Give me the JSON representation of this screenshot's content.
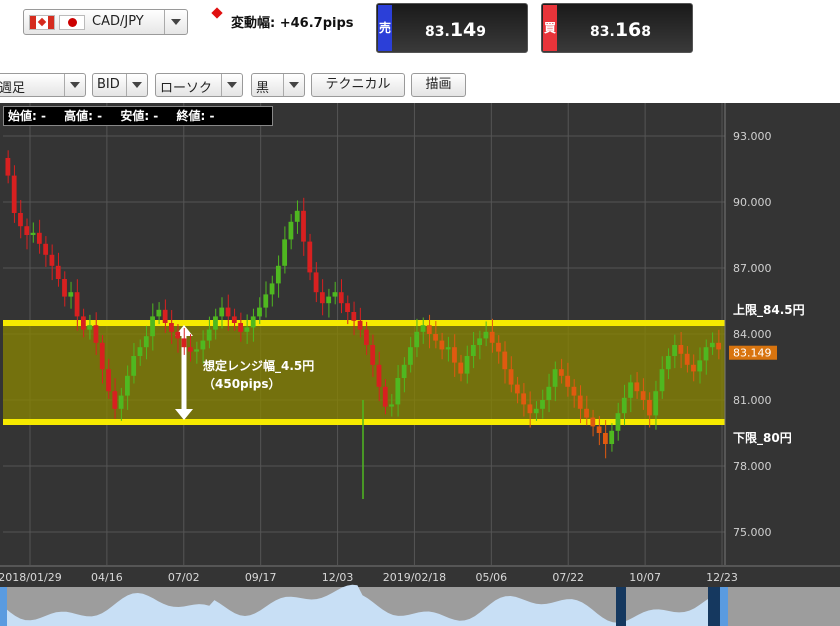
{
  "header": {
    "pair": "CAD/JPY",
    "change_label": "変動幅: +46.7pips",
    "sell": {
      "tag": "売",
      "price_a": "83.",
      "price_b": "14",
      "price_c": "9"
    },
    "buy": {
      "tag": "買",
      "price_a": "83.",
      "price_b": "16",
      "price_c": "8"
    }
  },
  "toolbar": {
    "period": "週足",
    "bid": "BID",
    "chart_type": "ローソク",
    "color": "黒",
    "technical": "テクニカル",
    "draw": "描画"
  },
  "ohlc": {
    "open": "始値: -",
    "high": "高値: -",
    "low": "安値: -",
    "close": "終値: -"
  },
  "annotations": {
    "upper": "上限_84.5円",
    "lower": "下限_80円",
    "range": "想定レンジ幅_4.5円",
    "range_pips": "（450pips）"
  },
  "current_price": "83.149",
  "colors": {
    "up": "#4fb820",
    "down": "#d82020",
    "down_alt": "#e05a10",
    "band": "#f6ea00",
    "price_tag": "#d8740f"
  },
  "chart_data": {
    "type": "candlestick",
    "y_ticks": [
      "93.000",
      "90.000",
      "87.000",
      "84.000",
      "81.000",
      "78.000",
      "75.000"
    ],
    "ylim": [
      73.5,
      94.5
    ],
    "x_ticks": [
      "2018/01/29",
      "04/16",
      "07/02",
      "09/17",
      "12/03",
      "2019/02/18",
      "05/06",
      "07/22",
      "10/07",
      "12/23"
    ],
    "range_band": [
      80,
      84.5
    ],
    "closes": [
      91.2,
      89.5,
      88.9,
      88.5,
      88.6,
      88.1,
      87.6,
      87.1,
      86.5,
      85.7,
      85.9,
      84.8,
      84.2,
      84.4,
      83.6,
      82.4,
      81.4,
      80.6,
      81.2,
      82.1,
      83.0,
      83.4,
      83.9,
      84.8,
      85.1,
      84.5,
      84.1,
      83.8,
      83.4,
      83.2,
      83.3,
      83.7,
      84.2,
      84.8,
      85.2,
      84.8,
      84.5,
      84.1,
      84.3,
      84.8,
      85.2,
      85.8,
      86.3,
      87.1,
      88.3,
      89.1,
      89.6,
      88.2,
      86.8,
      85.9,
      85.4,
      85.7,
      85.9,
      85.4,
      85.0,
      84.6,
      84.2,
      83.5,
      82.6,
      81.6,
      80.7,
      80.8,
      82.0,
      82.6,
      83.4,
      84.1,
      84.4,
      84.0,
      83.7,
      83.3,
      83.4,
      82.7,
      82.2,
      83.0,
      83.5,
      83.8,
      84.1,
      83.6,
      83.2,
      82.4,
      81.7,
      81.3,
      80.8,
      80.4,
      80.6,
      81.0,
      81.6,
      82.4,
      82.1,
      81.6,
      81.2,
      80.6,
      80.2,
      79.8,
      79.5,
      79.0,
      79.6,
      80.4,
      81.1,
      81.8,
      81.4,
      81.0,
      80.3,
      81.4,
      82.4,
      83.0,
      83.5,
      83.1,
      82.6,
      82.3,
      82.8,
      83.4,
      83.6,
      83.3
    ]
  }
}
